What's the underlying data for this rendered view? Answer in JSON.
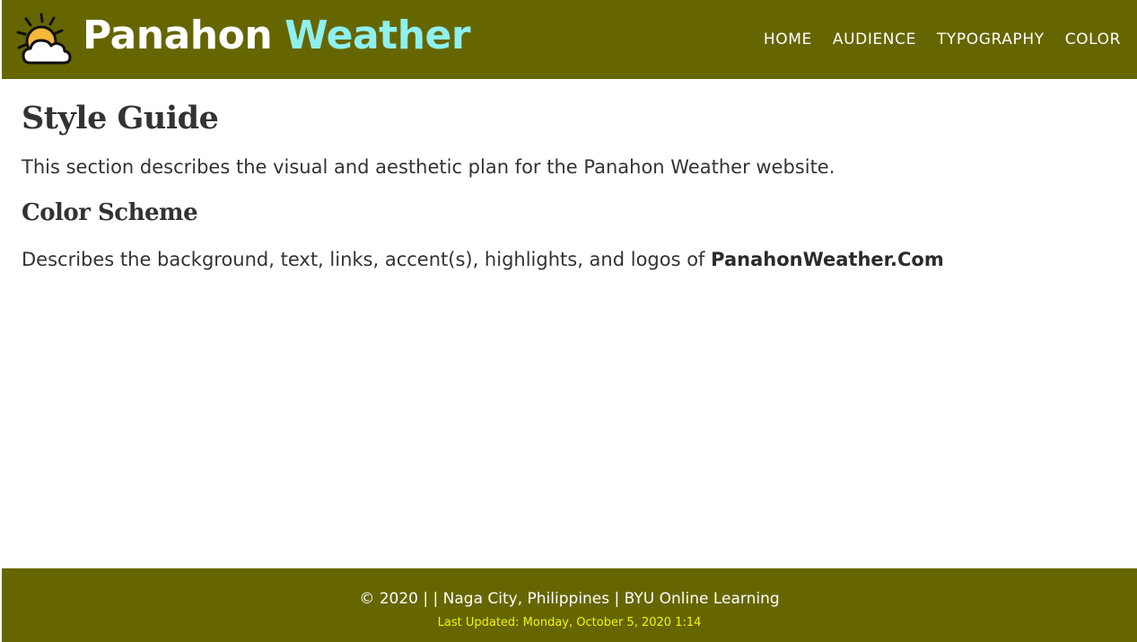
{
  "header": {
    "brand_part1": "Panahon",
    "brand_part2": "Weather",
    "logo_icon": "sun-behind-cloud-icon",
    "nav": [
      {
        "label": "HOME"
      },
      {
        "label": "AUDIENCE"
      },
      {
        "label": "TYPOGRAPHY"
      },
      {
        "label": "COLOR"
      }
    ]
  },
  "main": {
    "title": "Style Guide",
    "intro": "This section describes the visual and aesthetic plan for the Panahon Weather website.",
    "section_title": "Color Scheme",
    "section_text": "Describes the background, text, links, accent(s), highlights, and logos of",
    "section_brand": "PanahonWeather.Com"
  },
  "footer": {
    "copyright": "© 2020 | | Naga City, Philippines | BYU Online Learning",
    "last_updated": "Last Updated: Monday, October 5, 2020 1:14"
  },
  "colors": {
    "header_bg": "#666600",
    "brand_accent": "#8ff0f0",
    "updated_text": "#f5f500",
    "text": "#333333"
  }
}
